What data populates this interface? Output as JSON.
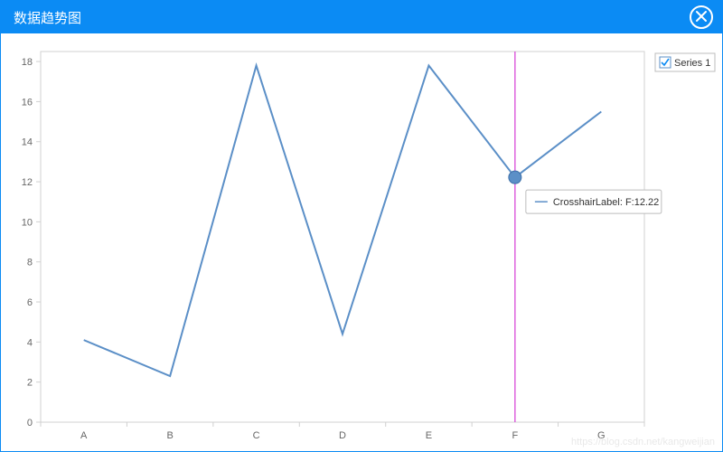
{
  "titlebar": {
    "title": "数据趋势图"
  },
  "legend": {
    "series1_label": "Series 1",
    "series1_checked": true
  },
  "tooltip": {
    "label": "CrosshairLabel: F:12.22"
  },
  "watermark": "https://blog.csdn.net/kangweijian",
  "colors": {
    "accent": "#0b8bf4",
    "line": "#5b8fc7",
    "crosshair": "#d63cd6",
    "marker_fill": "#5b8fc7",
    "axis": "#d0d0d0"
  },
  "chart_data": {
    "type": "line",
    "categories": [
      "A",
      "B",
      "C",
      "D",
      "E",
      "F",
      "G"
    ],
    "series": [
      {
        "name": "Series 1",
        "values": [
          4.1,
          2.3,
          17.8,
          4.4,
          17.8,
          12.22,
          15.5
        ]
      }
    ],
    "xlabel": "",
    "ylabel": "",
    "ylim": [
      0,
      18.5
    ],
    "y_ticks": [
      0,
      2,
      4,
      6,
      8,
      10,
      12,
      14,
      16,
      18
    ],
    "crosshair_category": "F",
    "crosshair_value": 12.22,
    "title": ""
  }
}
